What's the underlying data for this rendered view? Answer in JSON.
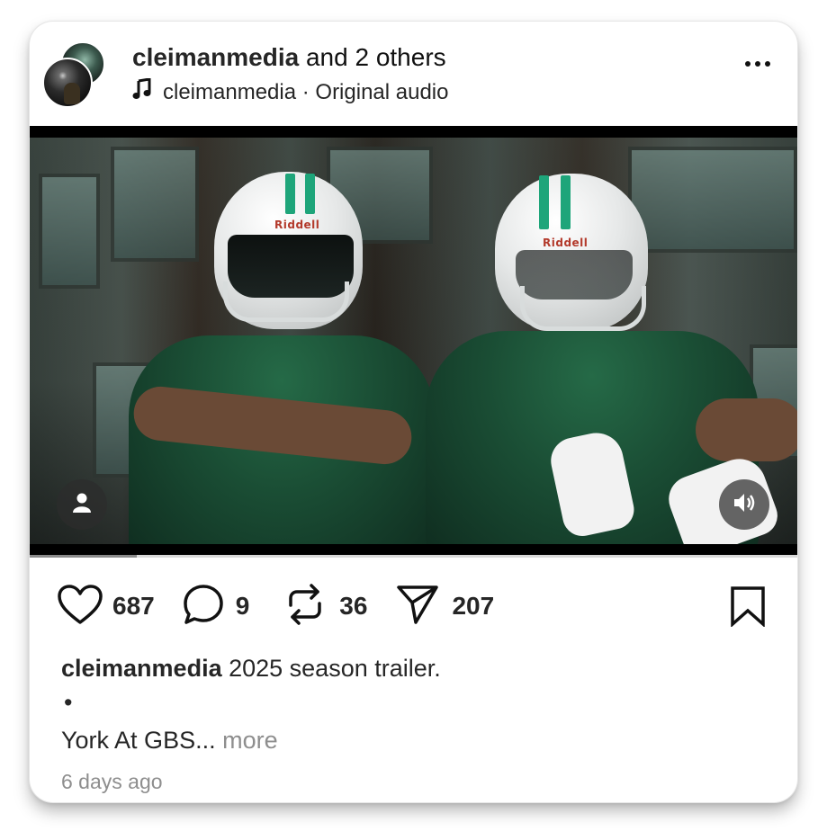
{
  "header": {
    "primary_user": "cleimanmedia",
    "collab_text": " and 2 others",
    "audio_icon": "music-note-icon",
    "audio_text": "cleimanmedia · Original audio",
    "more_icon": "more-options-icon"
  },
  "video": {
    "helmet_brand": "Riddell",
    "accent_color": "#1ea57a",
    "jersey_color": "#1a4d34",
    "tag_icon": "person-icon",
    "sound_icon": "speaker-icon",
    "progress": 0.14
  },
  "actions": {
    "like_icon": "heart-icon",
    "likes": "687",
    "comment_icon": "comment-icon",
    "comments": "9",
    "repost_icon": "repost-icon",
    "reposts": "36",
    "share_icon": "send-icon",
    "shares": "207",
    "save_icon": "bookmark-icon"
  },
  "caption": {
    "user": "cleimanmedia",
    "text": " 2025 season trailer.",
    "bullet": "•",
    "line2": "York At GBS... ",
    "more": "more",
    "timestamp": "6 days ago"
  }
}
